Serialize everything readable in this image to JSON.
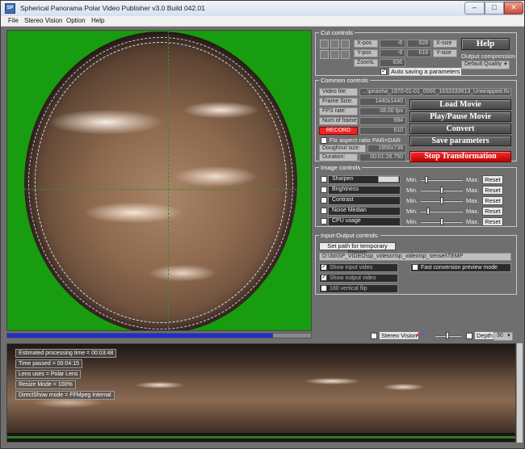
{
  "window": {
    "app_icon_text": "SP",
    "title": "Spherical Panorama Polar Video Publisher    v3.0 Build 042.01",
    "min_glyph": "–",
    "max_glyph": "□",
    "close_glyph": "✕"
  },
  "menu": [
    "File",
    "Stereo Vision",
    "Option",
    "Help"
  ],
  "video": {
    "progress_fraction": 0.875
  },
  "cut_controls": {
    "legend": "Cut controls",
    "xpos_label": "X-pos",
    "xpos_value": "-8",
    "ypos_label": "Y-pos",
    "ypos_value": "-9",
    "zoom_label": "ZoomL",
    "zoom_value": "636",
    "xsize_label": "X-size",
    "xsize_value": "628",
    "ysize_label": "Y-size",
    "ysize_value": "618",
    "help_label": "Help",
    "output_compression_label": "Output compression",
    "compression_value": "Default Quality",
    "auto_save_label": "Auto saving a parameters",
    "auto_save_checked": true
  },
  "common_controls": {
    "legend": "Common controls",
    "rows": [
      {
        "label": "Video file:",
        "value": "...\\piranha_1970-01-01_0000_1633333813_Unwrapped.flv"
      },
      {
        "label": "Frame Size:",
        "value": "1440x1440"
      },
      {
        "label": "FPS rate:",
        "value": "08.00 fps"
      },
      {
        "label": "Num of frames:",
        "value": "694"
      }
    ],
    "record_label": "RECORD",
    "record_value": "610",
    "fix_aspect_label": "Fix aspect ratio PAR=DAR",
    "doughnut_label": "Doughnut size:",
    "doughnut_value": "1856x738",
    "duration_label": "Duration:",
    "duration_value": "00:01:26.750",
    "buttons": {
      "load": "Load Movie",
      "play": "Play/Pause Movie",
      "convert": "Convert",
      "save": "Save parameters",
      "stop": "Stop Transformation"
    }
  },
  "image_controls": {
    "legend": "Image controls",
    "min_label": "Min.",
    "max_label": "Max.",
    "reset_label": "Reset",
    "items": [
      {
        "name": "Sharpen",
        "level": 0.1
      },
      {
        "name": "Brightness",
        "level": 0.5
      },
      {
        "name": "Contrast",
        "level": 0.5
      },
      {
        "name": "Noise Median",
        "level": 0.15
      },
      {
        "name": "CPU usage",
        "level": 0.5
      }
    ]
  },
  "io_controls": {
    "legend": "Input-Output controls:",
    "set_path_label": "Set path for temporary Stream",
    "path_value": "D:\\3d\\SP_VIDEO\\sp_videocr\\sp_video\\sp_sensel\\TEMP",
    "show_input_label": "Show input video",
    "show_output_label": "Show output video",
    "flip_label": "180 vertical flip",
    "fast_preview_label": "Fast conversion preview mode"
  },
  "bottom": {
    "stereo_label": "Stereo Vision",
    "depth_label": "Depth",
    "depth_value": "30"
  },
  "status": [
    "Estimated processing time = 00:03:48",
    "Time passed = 00:04:15",
    "Lens uses = Polar Lens",
    "Resize Mode = 100%",
    "DirectShow mode = FFMpeg Internal"
  ]
}
